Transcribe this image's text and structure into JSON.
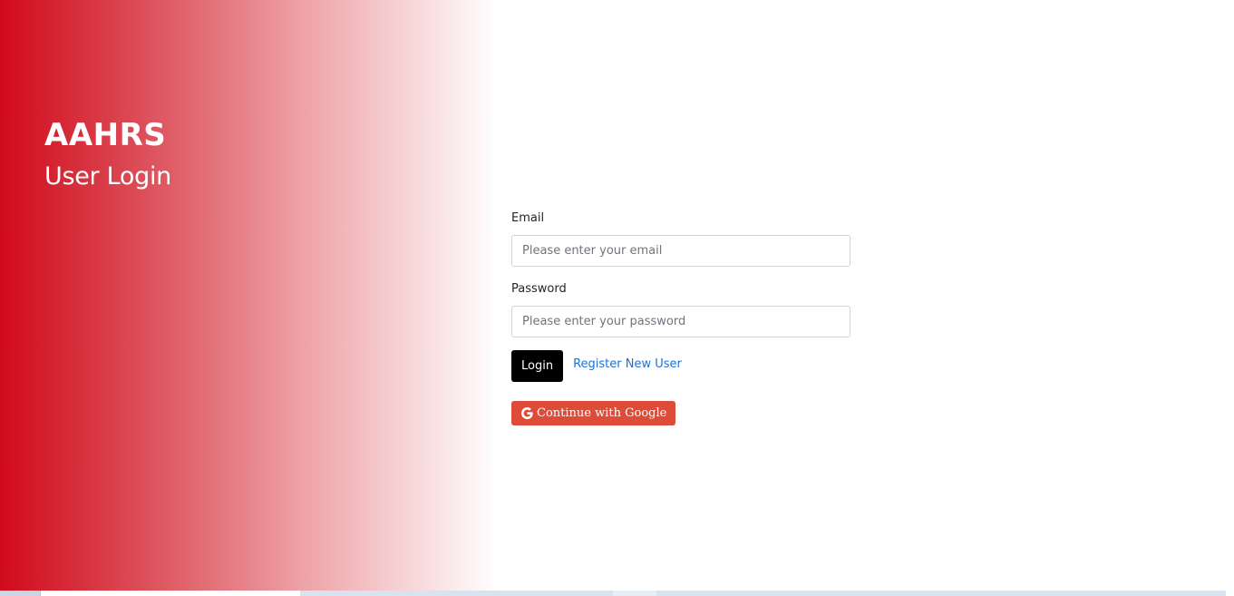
{
  "hero": {
    "brand": "AAHRS",
    "subtitle": "User Login",
    "gradient_color": "#d10a1b"
  },
  "form": {
    "email": {
      "label": "Email",
      "placeholder": "Please enter your email",
      "value": ""
    },
    "password": {
      "label": "Password",
      "placeholder": "Please enter your password",
      "value": ""
    },
    "login_label": "Login",
    "register_label": "Register New User",
    "google_label": "Continue with Google",
    "google_icon": "google-icon"
  },
  "colors": {
    "login_button": "#000000",
    "google_button": "#dd4b39",
    "link": "#1a73d9"
  }
}
